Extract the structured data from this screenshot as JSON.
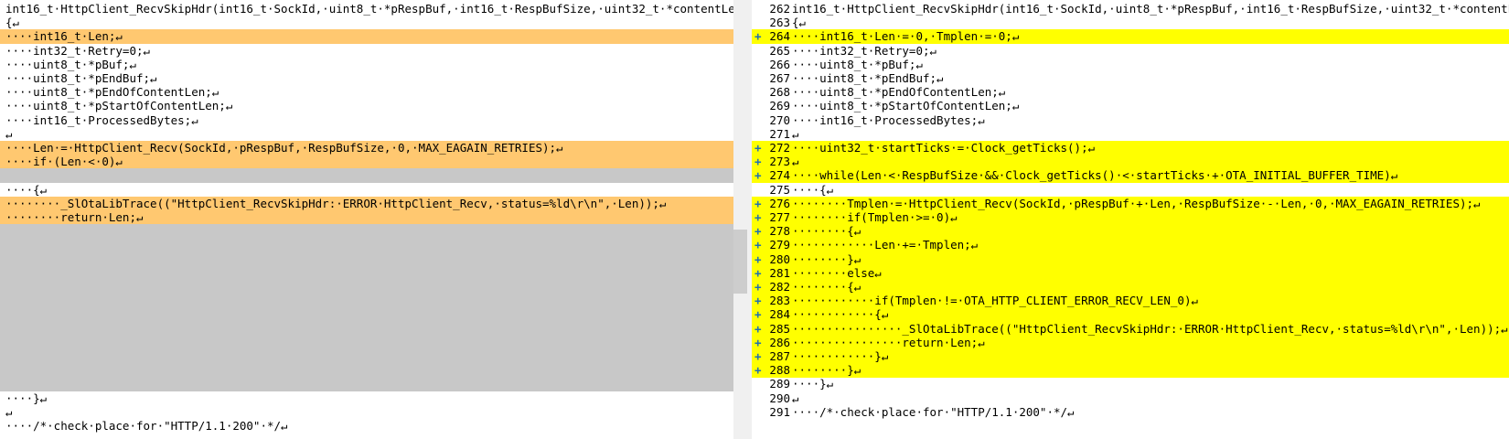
{
  "left": {
    "lines": [
      {
        "text": "int16_t·HttpClient_RecvSkipHdr(int16_t·SockId,·uint8_t·*pRespBuf,·int16_t·RespBufSize,·uint32_t·*contentLen)↵",
        "kind": "normal"
      },
      {
        "text": "{↵",
        "kind": "normal"
      },
      {
        "text": "····int16_t·Len;↵",
        "kind": "changed"
      },
      {
        "text": "····int32_t·Retry=0;↵",
        "kind": "normal"
      },
      {
        "text": "····uint8_t·*pBuf;↵",
        "kind": "normal"
      },
      {
        "text": "····uint8_t·*pEndBuf;↵",
        "kind": "normal"
      },
      {
        "text": "····uint8_t·*pEndOfContentLen;↵",
        "kind": "normal"
      },
      {
        "text": "····uint8_t·*pStartOfContentLen;↵",
        "kind": "normal"
      },
      {
        "text": "····int16_t·ProcessedBytes;↵",
        "kind": "normal"
      },
      {
        "text": "↵",
        "kind": "normal"
      },
      {
        "text": "····Len·=·HttpClient_Recv(SockId,·pRespBuf,·RespBufSize,·0,·MAX_EAGAIN_RETRIES);↵",
        "kind": "changed"
      },
      {
        "text": "····if·(Len·<·0)↵",
        "kind": "changed"
      },
      {
        "text": "",
        "kind": "filler"
      },
      {
        "text": "····{↵",
        "kind": "normal"
      },
      {
        "text": "········_SlOtaLibTrace((\"HttpClient_RecvSkipHdr:·ERROR·HttpClient_Recv,·status=%ld\\r\\n\",·Len));↵",
        "kind": "changed"
      },
      {
        "text": "········return·Len;↵",
        "kind": "changed"
      },
      {
        "text": "",
        "kind": "filler"
      },
      {
        "text": "",
        "kind": "filler"
      },
      {
        "text": "",
        "kind": "filler"
      },
      {
        "text": "",
        "kind": "filler"
      },
      {
        "text": "",
        "kind": "filler"
      },
      {
        "text": "",
        "kind": "filler"
      },
      {
        "text": "",
        "kind": "filler"
      },
      {
        "text": "",
        "kind": "filler"
      },
      {
        "text": "",
        "kind": "filler"
      },
      {
        "text": "",
        "kind": "filler"
      },
      {
        "text": "",
        "kind": "filler"
      },
      {
        "text": "",
        "kind": "filler"
      },
      {
        "text": "····}↵",
        "kind": "normal"
      },
      {
        "text": "↵",
        "kind": "normal"
      },
      {
        "text": "····/*·check·place·for·\"HTTP/1.1·200\"·*/↵",
        "kind": "normal"
      }
    ]
  },
  "right": {
    "lines": [
      {
        "num": "262",
        "marker": "",
        "text": "int16_t·HttpClient_RecvSkipHdr(int16_t·SockId,·uint8_t·*pRespBuf,·int16_t·RespBufSize,·uint32_t·*contentLen)↵",
        "kind": "normal"
      },
      {
        "num": "263",
        "marker": "",
        "text": "{↵",
        "kind": "normal"
      },
      {
        "num": "264",
        "marker": "+",
        "text": "····int16_t·Len·=·0,·Tmplen·=·0;↵",
        "kind": "added"
      },
      {
        "num": "265",
        "marker": "",
        "text": "····int32_t·Retry=0;↵",
        "kind": "normal"
      },
      {
        "num": "266",
        "marker": "",
        "text": "····uint8_t·*pBuf;↵",
        "kind": "normal"
      },
      {
        "num": "267",
        "marker": "",
        "text": "····uint8_t·*pEndBuf;↵",
        "kind": "normal"
      },
      {
        "num": "268",
        "marker": "",
        "text": "····uint8_t·*pEndOfContentLen;↵",
        "kind": "normal"
      },
      {
        "num": "269",
        "marker": "",
        "text": "····uint8_t·*pStartOfContentLen;↵",
        "kind": "normal"
      },
      {
        "num": "270",
        "marker": "",
        "text": "····int16_t·ProcessedBytes;↵",
        "kind": "normal"
      },
      {
        "num": "271",
        "marker": "",
        "text": "↵",
        "kind": "normal"
      },
      {
        "num": "272",
        "marker": "+",
        "text": "····uint32_t·startTicks·=·Clock_getTicks();↵",
        "kind": "added"
      },
      {
        "num": "273",
        "marker": "+",
        "text": "↵",
        "kind": "added"
      },
      {
        "num": "274",
        "marker": "+",
        "text": "····while(Len·<·RespBufSize·&&·Clock_getTicks()·<·startTicks·+·OTA_INITIAL_BUFFER_TIME)↵",
        "kind": "added"
      },
      {
        "num": "275",
        "marker": "",
        "text": "····{↵",
        "kind": "normal"
      },
      {
        "num": "276",
        "marker": "+",
        "text": "········Tmplen·=·HttpClient_Recv(SockId,·pRespBuf·+·Len,·RespBufSize·-·Len,·0,·MAX_EAGAIN_RETRIES);↵",
        "kind": "added"
      },
      {
        "num": "277",
        "marker": "+",
        "text": "········if(Tmplen·>=·0)↵",
        "kind": "added"
      },
      {
        "num": "278",
        "marker": "+",
        "text": "········{↵",
        "kind": "added"
      },
      {
        "num": "279",
        "marker": "+",
        "text": "············Len·+=·Tmplen;↵",
        "kind": "added"
      },
      {
        "num": "280",
        "marker": "+",
        "text": "········}↵",
        "kind": "added"
      },
      {
        "num": "281",
        "marker": "+",
        "text": "········else↵",
        "kind": "added"
      },
      {
        "num": "282",
        "marker": "+",
        "text": "········{↵",
        "kind": "added"
      },
      {
        "num": "283",
        "marker": "+",
        "text": "············if(Tmplen·!=·OTA_HTTP_CLIENT_ERROR_RECV_LEN_0)↵",
        "kind": "added"
      },
      {
        "num": "284",
        "marker": "+",
        "text": "············{↵",
        "kind": "added"
      },
      {
        "num": "285",
        "marker": "+",
        "text": "················_SlOtaLibTrace((\"HttpClient_RecvSkipHdr:·ERROR·HttpClient_Recv,·status=%ld\\r\\n\",·Len));↵",
        "kind": "added"
      },
      {
        "num": "286",
        "marker": "+",
        "text": "················return·Len;↵",
        "kind": "added"
      },
      {
        "num": "287",
        "marker": "+",
        "text": "············}↵",
        "kind": "added"
      },
      {
        "num": "288",
        "marker": "+",
        "text": "········}↵",
        "kind": "added"
      },
      {
        "num": "289",
        "marker": "",
        "text": "····}↵",
        "kind": "normal"
      },
      {
        "num": "290",
        "marker": "",
        "text": "↵",
        "kind": "normal"
      },
      {
        "num": "291",
        "marker": "",
        "text": "····/*·check·place·for·\"HTTP/1.1·200\"·*/↵",
        "kind": "normal"
      }
    ]
  },
  "colors": {
    "changed": "#ffc870",
    "added": "#ffff00",
    "filler": "#c8c8c8",
    "marker": "#1f6fb0"
  }
}
